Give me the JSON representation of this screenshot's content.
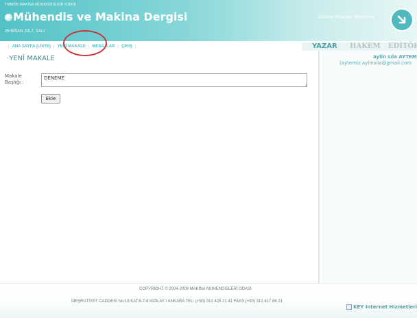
{
  "header": {
    "org": "TMMOB MAKİNA MÜHENDİSLERİ ODASI",
    "brand": "Mühendis ve Makina Dergisi",
    "date": "25 NİSAN 2017, SALI",
    "online_label": "Online Makale Yönetimi",
    "brand_color": "#52c2c7",
    "logo_icon": "arrow-circle-icon"
  },
  "nav": {
    "items": [
      {
        "label": "ANA SAYFA (LİSTE)"
      },
      {
        "label": "YENİ MAKALE"
      },
      {
        "label": "MESAJLAR"
      },
      {
        "label": "ÇIKIŞ"
      }
    ],
    "annotation_color": "#c8333a"
  },
  "roles": {
    "yazar": "YAZAR",
    "hakem": "HAKEM",
    "editor": "EDİTÖR"
  },
  "user": {
    "name": "aylin sıla AYTEM",
    "email": "(aytemiz.aylinsila@gmail.com"
  },
  "form": {
    "section_title": "YENİ MAKALE",
    "label_line1": "Makale",
    "label_line2": "Başlığı :",
    "title_value": "DENEME",
    "submit_label": "Ekle"
  },
  "footer": {
    "copyright": "COPYRIGHT © 2004-2006 MAKİNA MÜHENDİSLERİ ODASI",
    "address": "MEŞRUTİYET CADDESİ No:19 KAT:6-7-8 KIZILAY / ANKARA TEL: (+90) 312 425 21 41 FAKS:(+90) 312 417 86 21",
    "key_logo": "KEY Internet Hizmetleri"
  }
}
